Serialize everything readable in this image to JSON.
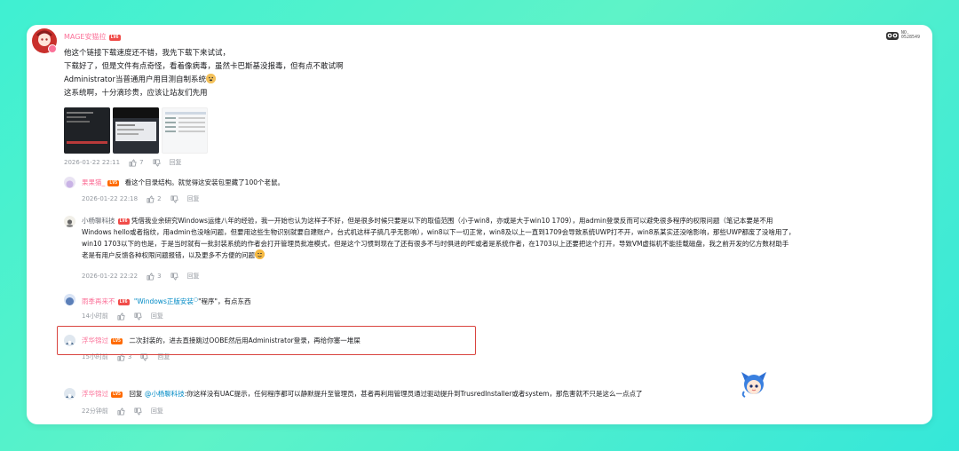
{
  "uid": {
    "label": "NO.",
    "number": "0528549"
  },
  "main_comment": {
    "username": "MAGE安猫拉",
    "level": "LV6",
    "lines": [
      "他这个链接下载速度还不错，我先下载下来试试，",
      "下载好了，但是文件有点奇怪，看着像病毒，虽然卡巴斯基没报毒，但有点不敢试啊",
      "Administrator当普通用户用目测自制系统",
      "这系统啊，十分滴珍贵，应该让站友们先用"
    ],
    "time": "2026-01-22 22:11",
    "likes": "7",
    "reply_label": "回复"
  },
  "replies": [
    {
      "username": "果果猫_",
      "level": "LV5",
      "text": "看这个目录结构。就觉得这安装包里藏了100个老鼠。",
      "time": "2026-01-22 22:18",
      "likes": "2",
      "reply_label": "回复"
    },
    {
      "username": "小杨聊科技",
      "level": "LV6",
      "lines": [
        "凭借我业余研究Windows运维八年的经验，我一开始也认为这样子不好，但是很多时候只要是以下的取值范围（小于win8，亦或是大于win10 1709），用admin登录反而可以避免很多程序的权限问题（笔记本要是不用",
        "Windows hello或者指纹，用admin也没啥问题，但要用这些生物识别就要自建账户，台式机这样子搞几乎无影响），win8以下一切正常，win8及以上一直到1709会导致系统UWP打不开，win8系某实还没啥影响，那些UWP都废了没啥用了，",
        "win10 1703以下的也是，于是当时就有一批封装系统的作者会打开管理员批准模式，但是这个习惯到现在了还有很多不与时俱进的PE或者是系统作者，在1703以上还要把这个打开，导致VM虚拟机不能挂载磁盘，我之前开发的亿方数材助手",
        "老是有用户反馈各种权限问题报错，以及更多不方便的问题"
      ],
      "time": "2026-01-22 22:22",
      "likes": "3",
      "reply_label": "回复"
    },
    {
      "username": "雨季再来不",
      "level": "LV6",
      "link_text": "\"Windows正版安装",
      "text_after": "\"程序\"，有点东西",
      "time": "14小时前",
      "reply_label": "回复"
    },
    {
      "username": "浮华锦过",
      "level": "LV5",
      "text": "二次封装的，进去直接跳过OOBE然后用Administrator登录，再给你塞一堆屎",
      "time": "15小时前",
      "likes": "3",
      "reply_label": "回复"
    },
    {
      "username": "浮华锦过",
      "level": "LV5",
      "reply_prefix": "回复",
      "mention": "@小杨聊科技",
      "text": ":你这样没有UAC提示，任何程序都可以静默提升至管理员，甚者再利用管理员通过驱动提升到TrusredInstaller或者system，那危害就不只是这么一点点了",
      "time": "22分钟前",
      "reply_label": "回复"
    }
  ],
  "colors": {
    "accent_pink": "#fb7299",
    "link_blue": "#008ac5",
    "meta_gray": "#9499a0",
    "highlight_red": "#d9443f"
  }
}
